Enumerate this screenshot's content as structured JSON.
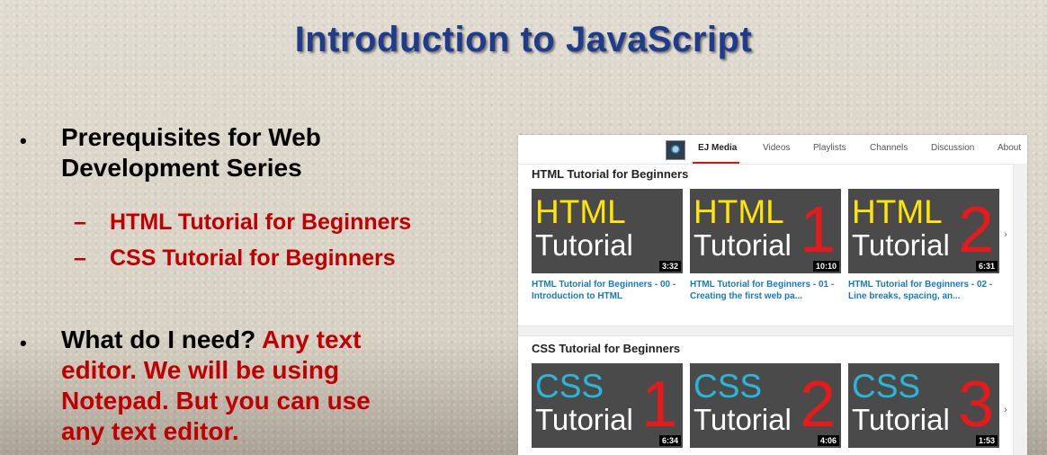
{
  "slide": {
    "title": "Introduction to JavaScript",
    "bullet_glyph": "•",
    "bullet1": {
      "line1": "Prerequisites for Web",
      "line2": "Development Series"
    },
    "dash_glyph": "–",
    "sub_items": [
      "HTML Tutorial for Beginners",
      "CSS Tutorial for Beginners"
    ],
    "bullet2": {
      "black_text": "What do I need?",
      "red_line1": " Any text",
      "red_line2": "editor.  We will be using",
      "red_line3": "Notepad.  But you can use",
      "red_line4": "any text editor."
    }
  },
  "youtube": {
    "channel_name": "EJ Media",
    "nav": [
      "Videos",
      "Playlists",
      "Channels",
      "Discussion",
      "About"
    ],
    "next_glyph": "›",
    "playlists": [
      {
        "title": "HTML Tutorial for Beginners",
        "videos": [
          {
            "thumb_word": "HTML",
            "thumb_sub": "Tutorial",
            "thumb_num": "",
            "duration": "3:32",
            "title": "HTML Tutorial for Beginners - 00 - Introduction to HTML"
          },
          {
            "thumb_word": "HTML",
            "thumb_sub": "Tutorial",
            "thumb_num": "1",
            "duration": "10:10",
            "title": "HTML Tutorial for Beginners - 01 - Creating the first web pa..."
          },
          {
            "thumb_word": "HTML",
            "thumb_sub": "Tutorial",
            "thumb_num": "2",
            "duration": "6:31",
            "title": "HTML Tutorial for Beginners - 02 - Line breaks, spacing, an..."
          }
        ]
      },
      {
        "title": "CSS Tutorial for Beginners",
        "videos": [
          {
            "thumb_word": "CSS",
            "thumb_sub": "Tutorial",
            "thumb_num": "1",
            "duration": "6:34"
          },
          {
            "thumb_word": "CSS",
            "thumb_sub": "Tutorial",
            "thumb_num": "2",
            "duration": "4:06"
          },
          {
            "thumb_word": "CSS",
            "thumb_sub": "Tutorial",
            "thumb_num": "3",
            "duration": "1:53"
          }
        ]
      }
    ]
  },
  "colors": {
    "title_blue": "#1f3c8c",
    "accent_red": "#c00000",
    "html_yellow": "#ffe600",
    "css_cyan": "#29b6d8",
    "link_blue": "#167ac6"
  }
}
